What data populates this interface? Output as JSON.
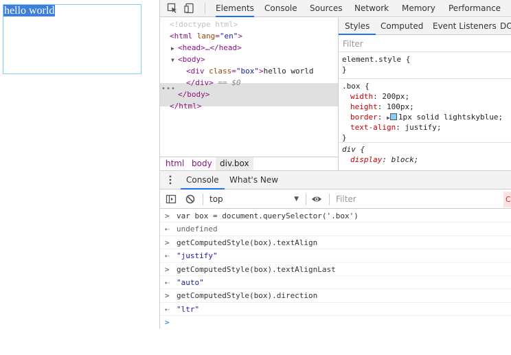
{
  "page": {
    "box_text": "hello world"
  },
  "devtools": {
    "main_tabs": [
      "Elements",
      "Console",
      "Sources",
      "Network",
      "Memory",
      "Performance"
    ],
    "active_main_tab": "Elements",
    "dom": {
      "doctype": "<!doctype html>",
      "html_open_tag": "<html",
      "html_attr_name": "lang",
      "html_attr_val": "\"en\"",
      "head_line": "<head>…</head>",
      "body_open": "<body>",
      "div_open_tag": "<div",
      "div_attr_name": "class",
      "div_attr_val": "\"box\"",
      "div_text": "hello world",
      "div_close": "</div>",
      "div_marker": "== $0",
      "body_close": "</body>",
      "html_close": "</html>",
      "dots": "•••"
    },
    "breadcrumb": [
      "html",
      "body",
      "div.box"
    ],
    "styles": {
      "tabs": [
        "Styles",
        "Computed",
        "Event Listeners",
        "DO"
      ],
      "filter_placeholder": "Filter",
      "element_style_selector": "element.style {",
      "close_brace": "}",
      "box_selector": ".box {",
      "box_props": [
        {
          "name": "width",
          "value": "200px;"
        },
        {
          "name": "height",
          "value": "100px;"
        },
        {
          "name": "border",
          "value": "1px solid lightskyblue;"
        },
        {
          "name": "text-align",
          "value": "justify;"
        }
      ],
      "swatch_color": "#87cefa",
      "div_selector": "div {",
      "div_props": [
        {
          "name": "display",
          "value": "block;"
        }
      ]
    },
    "drawer": {
      "tabs": [
        "Console",
        "What's New"
      ],
      "active_tab": "Console",
      "context": "top",
      "filter_placeholder": "Filter",
      "filter_edge": "C"
    },
    "console_lines": [
      {
        "kind": "input",
        "text": "var box = document.querySelector('.box')"
      },
      {
        "kind": "output",
        "text": "undefined"
      },
      {
        "kind": "input",
        "text": "getComputedStyle(box).textAlign"
      },
      {
        "kind": "output",
        "text": "\"justify\""
      },
      {
        "kind": "input",
        "text": "getComputedStyle(box).textAlignLast"
      },
      {
        "kind": "output",
        "text": "\"auto\""
      },
      {
        "kind": "input",
        "text": "getComputedStyle(box).direction"
      },
      {
        "kind": "output",
        "text": "\"ltr\""
      }
    ],
    "prompt_chevron": ">",
    "input_chevron": ">",
    "output_chevron": "⇠"
  },
  "colors": {
    "accent": "#1a73e8",
    "tag": "#881280",
    "attr_name": "#994500",
    "attr_value": "#1a1aa6",
    "property": "#c80000",
    "selection": "#3e7fd8"
  }
}
